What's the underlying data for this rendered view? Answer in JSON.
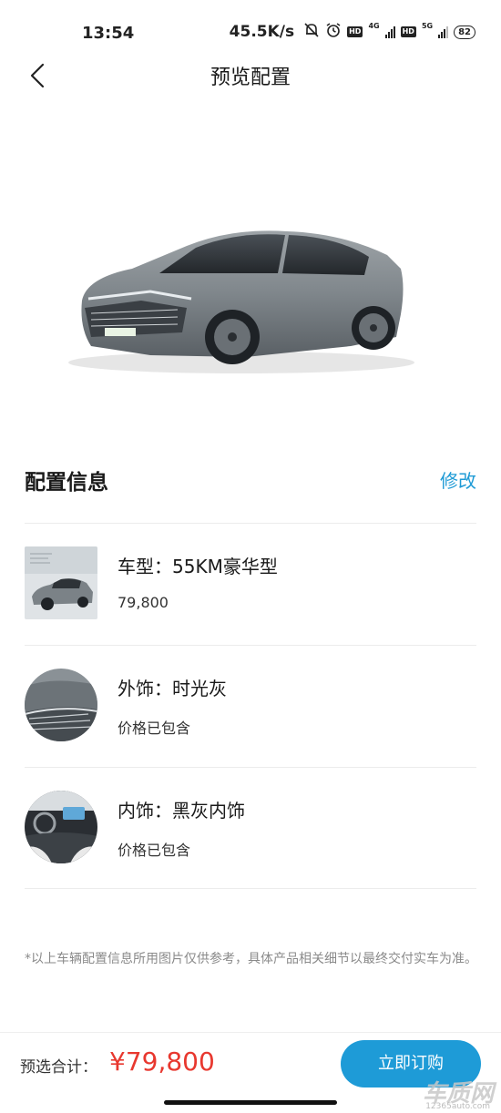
{
  "status_bar": {
    "time": "13:54",
    "net_speed": "45.5K/s",
    "hd1": "HD",
    "sig1": "4G",
    "hd2": "HD",
    "sig2": "5G",
    "battery": "82"
  },
  "nav": {
    "title": "预览配置",
    "back_icon": "chevron-left-icon"
  },
  "config": {
    "section_title": "配置信息",
    "edit_label": "修改",
    "items": [
      {
        "name": "车型：55KM豪华型",
        "sub": "79,800",
        "thumb": "car-model-thumbnail"
      },
      {
        "name": "外饰：时光灰",
        "sub": "价格已包含",
        "thumb": "exterior-color-thumbnail"
      },
      {
        "name": "内饰：黑灰内饰",
        "sub": "价格已包含",
        "thumb": "interior-thumbnail"
      }
    ]
  },
  "disclaimer": "*以上车辆配置信息所用图片仅供参考，具体产品相关细节以最终交付实车为准。",
  "bottom": {
    "total_label": "预选合计：",
    "total_price": "¥79,800",
    "order_button": "立即订购"
  },
  "watermark": {
    "main": "车质网",
    "sub": "12365auto.com"
  },
  "colors": {
    "accent": "#1e9bd7",
    "price": "#e8382f",
    "car_body": "#7d8489"
  }
}
